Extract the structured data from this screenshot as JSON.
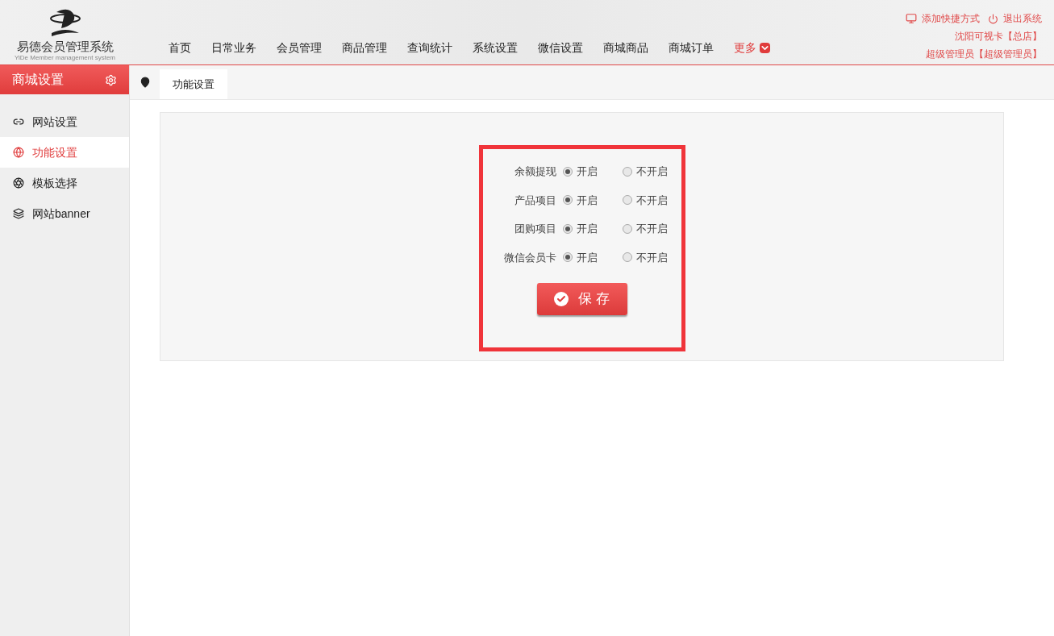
{
  "logo": {
    "title": "易德会员管理系统",
    "subtitle": "YiDe Member management system"
  },
  "nav": [
    {
      "label": "首页",
      "kind": "link"
    },
    {
      "label": "日常业务",
      "kind": "link"
    },
    {
      "label": "会员管理",
      "kind": "link"
    },
    {
      "label": "商品管理",
      "kind": "link"
    },
    {
      "label": "查询统计",
      "kind": "link"
    },
    {
      "label": "系统设置",
      "kind": "link"
    },
    {
      "label": "微信设置",
      "kind": "link"
    },
    {
      "label": "商城商品",
      "kind": "link"
    },
    {
      "label": "商城订单",
      "kind": "link"
    },
    {
      "label": "更多",
      "kind": "more"
    }
  ],
  "top_links": [
    {
      "label": "添加快捷方式",
      "kind": "shortcut"
    },
    {
      "label": "退出系统",
      "kind": "logout"
    }
  ],
  "store": "沈阳可视卡【总店】",
  "user": "超级管理员【超级管理员】",
  "sidebar": {
    "title": "商城设置",
    "items": [
      {
        "label": "网站设置",
        "selected": false,
        "kind": "link"
      },
      {
        "label": "功能设置",
        "selected": true,
        "kind": "globe"
      },
      {
        "label": "模板选择",
        "selected": false,
        "kind": "template"
      },
      {
        "label": "网站banner",
        "selected": false,
        "kind": "banner"
      }
    ]
  },
  "tabs": [
    {
      "label": "功能设置",
      "selected": true
    }
  ],
  "form": {
    "rows": [
      {
        "label": "余额提现",
        "options": [
          {
            "label": "开启",
            "selected": true
          },
          {
            "label": "不开启",
            "selected": false
          }
        ]
      },
      {
        "label": "产品项目",
        "options": [
          {
            "label": "开启",
            "selected": true
          },
          {
            "label": "不开启",
            "selected": false
          }
        ]
      },
      {
        "label": "团购项目",
        "options": [
          {
            "label": "开启",
            "selected": true
          },
          {
            "label": "不开启",
            "selected": false
          }
        ]
      },
      {
        "label": "微信会员卡",
        "options": [
          {
            "label": "开启",
            "selected": true
          },
          {
            "label": "不开启",
            "selected": false
          }
        ]
      }
    ],
    "save": "保 存"
  }
}
